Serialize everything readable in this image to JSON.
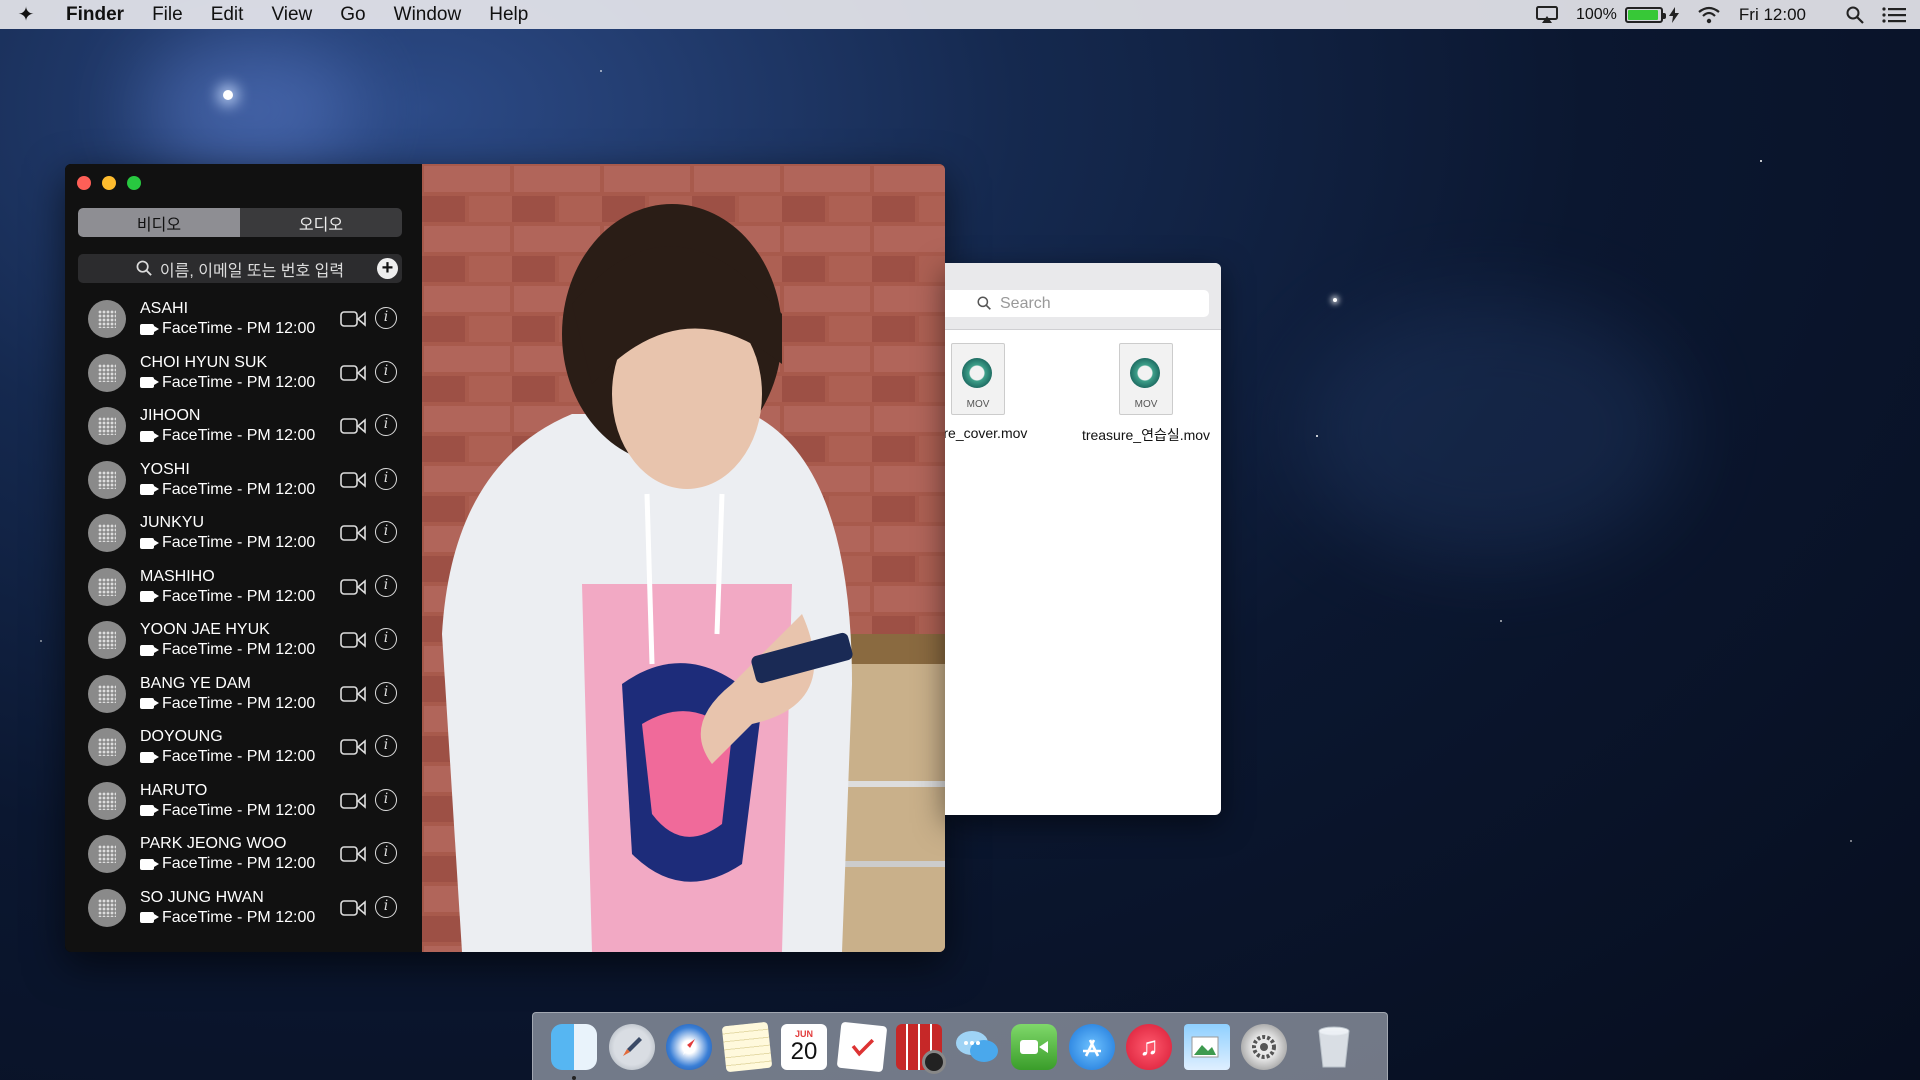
{
  "menubar": {
    "apple_glyph": "✦",
    "items": [
      "Finder",
      "File",
      "Edit",
      "View",
      "Go",
      "Window",
      "Help"
    ],
    "battery_percent": "100%",
    "battery_level": 1.0,
    "clock": "Fri 12:00"
  },
  "facetime": {
    "tabs": {
      "video": "비디오",
      "audio": "오디오"
    },
    "search_placeholder": "이름, 이메일 또는 번호 입력",
    "add_glyph": "+",
    "info_glyph": "i",
    "contacts": [
      {
        "name": "ASAHI",
        "detail": "FaceTime - PM 12:00"
      },
      {
        "name": "CHOI HYUN SUK",
        "detail": "FaceTime - PM 12:00"
      },
      {
        "name": "JIHOON",
        "detail": "FaceTime - PM 12:00"
      },
      {
        "name": "YOSHI",
        "detail": "FaceTime - PM 12:00"
      },
      {
        "name": "JUNKYU",
        "detail": "FaceTime - PM 12:00"
      },
      {
        "name": "MASHIHO",
        "detail": "FaceTime - PM 12:00"
      },
      {
        "name": "YOON JAE HYUK",
        "detail": "FaceTime - PM 12:00"
      },
      {
        "name": "BANG YE DAM",
        "detail": "FaceTime - PM 12:00"
      },
      {
        "name": "DOYOUNG",
        "detail": "FaceTime - PM 12:00"
      },
      {
        "name": "HARUTO",
        "detail": "FaceTime - PM 12:00"
      },
      {
        "name": "PARK JEONG WOO",
        "detail": "FaceTime - PM 12:00"
      },
      {
        "name": "SO JUNG HWAN",
        "detail": "FaceTime - PM 12:00"
      }
    ]
  },
  "finder": {
    "search_placeholder": "Search",
    "files": [
      {
        "name": "sure_cover.mov",
        "badge": "MOV"
      },
      {
        "name": "treasure_연습실.mov",
        "badge": "MOV"
      }
    ]
  },
  "dock": {
    "calendar_month": "JUN",
    "calendar_day": "20",
    "music_glyph": "♫",
    "items": [
      "finder-icon",
      "launchpad-icon",
      "safari-icon",
      "notes-icon",
      "calendar-icon",
      "reminders-icon",
      "photo-booth-icon",
      "messages-icon",
      "facetime-icon",
      "app-store-icon",
      "itunes-icon",
      "preview-icon",
      "system-preferences-icon",
      "trash-icon"
    ]
  },
  "colors": {
    "desktop_dark": "#0b1730",
    "menubar_bg": "#e6e6eb",
    "sidebar_bg": "#111111",
    "battery_fill": "#37c837",
    "close": "#fe5f57",
    "minimize": "#febc2e",
    "maximize": "#28c840"
  }
}
